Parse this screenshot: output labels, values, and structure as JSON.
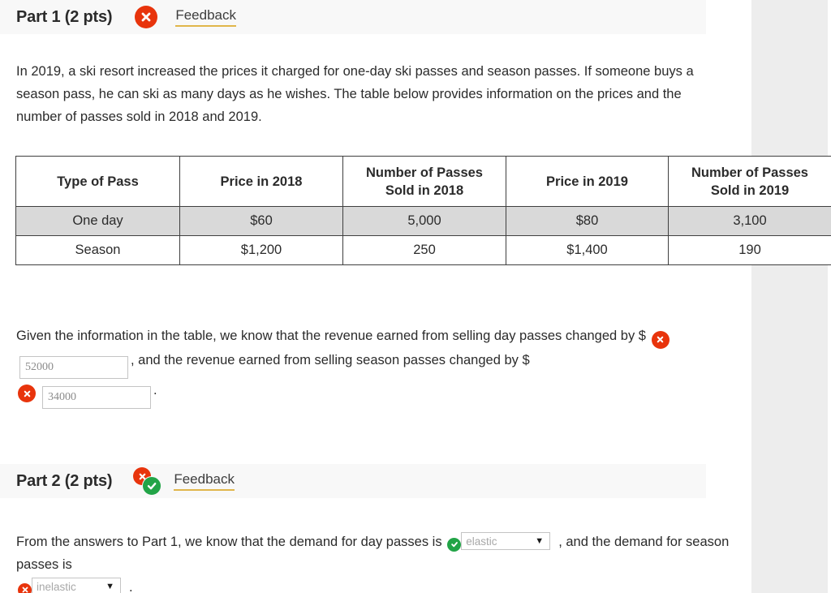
{
  "right_panel": {
    "color": "#ededed"
  },
  "colors": {
    "error_red": "#e8340c",
    "success_green": "#22a447",
    "link_underline": "#e0b64b",
    "header_bar": "#f8f8f8",
    "table_row_shaded": "#d9d9d9",
    "table_border": "#3f3f3f"
  },
  "part1": {
    "title": "Part 1 (2 pts)",
    "status_icons": [
      "error-x-icon"
    ],
    "feedback_label": "Feedback",
    "intro_paragraph": "In 2019, a ski resort increased the prices it charged for one-day ski passes and season passes. If someone buys a season pass, he can ski as many days as he wishes. The table below provides information on the prices and the number of passes sold in 2018 and 2019.",
    "table": {
      "headers": [
        "Type of Pass",
        "Price in 2018",
        "Number of Passes Sold in 2018",
        "Price in 2019",
        "Number of Passes Sold in 2019"
      ],
      "header_lines": [
        [
          "Type of Pass"
        ],
        [
          "Price in 2018"
        ],
        [
          "Number of Passes",
          "Sold in 2018"
        ],
        [
          "Price in 2019"
        ],
        [
          "Number of Passes",
          "Sold in 2019"
        ]
      ],
      "rows": [
        {
          "shaded": true,
          "cells": [
            "One day",
            "$60",
            "5,000",
            "$80",
            "3,100"
          ]
        },
        {
          "shaded": false,
          "cells": [
            "Season",
            "$1,200",
            "250",
            "$1,400",
            "190"
          ]
        }
      ]
    },
    "answer": {
      "text_1": "Given the information in the table, we know that the revenue earned from selling day passes changed by $",
      "field_1": {
        "value": "52000",
        "status": "error-x-icon"
      },
      "text_2": ", and the revenue earned from selling season passes changed by $",
      "field_2": {
        "value": "34000",
        "status": "error-x-icon"
      },
      "text_3": "."
    }
  },
  "part2": {
    "title": "Part 2 (2 pts)",
    "status_icons": [
      "error-x-icon",
      "success-check-icon"
    ],
    "feedback_label": "Feedback",
    "answer": {
      "text_1": "From the answers to Part 1, we know that the demand for day passes is",
      "select_1": {
        "value": "elastic",
        "status": "success-check-icon"
      },
      "text_2": ", and the demand for season passes is",
      "select_2": {
        "value": "inelastic",
        "status": "error-x-icon"
      },
      "text_3": "."
    }
  }
}
